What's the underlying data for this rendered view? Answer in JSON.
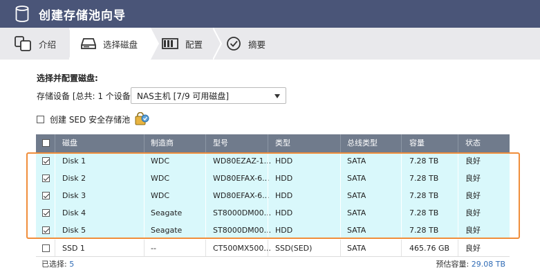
{
  "window": {
    "title": "创建存储池向导",
    "title_icon": "database-icon"
  },
  "steps": [
    {
      "label": "介绍",
      "icon": "intro-icon"
    },
    {
      "label": "选择磁盘",
      "icon": "disk-drive-icon"
    },
    {
      "label": "配置",
      "icon": "raid-config-icon"
    },
    {
      "label": "摘要",
      "icon": "check-circle-icon"
    }
  ],
  "form": {
    "section_title": "选择并配置磁盘:",
    "device_label": "存储设备 [总共: 1 个设备]:",
    "device_value": "NAS主机 [7/9 可用磁盘]",
    "sed_label": "创建 SED 安全存储池"
  },
  "table": {
    "headers": [
      "磁盘",
      "制造商",
      "型号",
      "类型",
      "总线类型",
      "容量",
      "状态"
    ],
    "rows": [
      {
        "checked": true,
        "disk": "Disk 1",
        "vendor": "WDC",
        "model": "WD80EZAZ-1...",
        "type": "HDD",
        "bus": "SATA",
        "capacity": "7.28 TB",
        "status": "良好"
      },
      {
        "checked": true,
        "disk": "Disk 2",
        "vendor": "WDC",
        "model": "WD80EFAX-6...",
        "type": "HDD",
        "bus": "SATA",
        "capacity": "7.28 TB",
        "status": "良好"
      },
      {
        "checked": true,
        "disk": "Disk 3",
        "vendor": "WDC",
        "model": "WD80EFAX-6...",
        "type": "HDD",
        "bus": "SATA",
        "capacity": "7.28 TB",
        "status": "良好"
      },
      {
        "checked": true,
        "disk": "Disk 4",
        "vendor": "Seagate",
        "model": "ST8000DM00...",
        "type": "HDD",
        "bus": "SATA",
        "capacity": "7.28 TB",
        "status": "良好"
      },
      {
        "checked": true,
        "disk": "Disk 5",
        "vendor": "Seagate",
        "model": "ST8000DM00...",
        "type": "HDD",
        "bus": "SATA",
        "capacity": "7.28 TB",
        "status": "良好"
      },
      {
        "checked": false,
        "disk": "SSD 1",
        "vendor": "--",
        "model": "CT500MX500...",
        "type": "SSD(SED)",
        "bus": "SATA",
        "capacity": "465.76 GB",
        "status": "良好"
      }
    ]
  },
  "footer": {
    "selected_label": "已选择: ",
    "selected_count": "5",
    "estimate_label": "预估容量: ",
    "estimate_value": "29.08 TB"
  },
  "colors": {
    "titlebar": "#4a5578",
    "selected_row": "#d9f8fb",
    "highlight": "#f08d3a",
    "header": "#707b8c"
  }
}
